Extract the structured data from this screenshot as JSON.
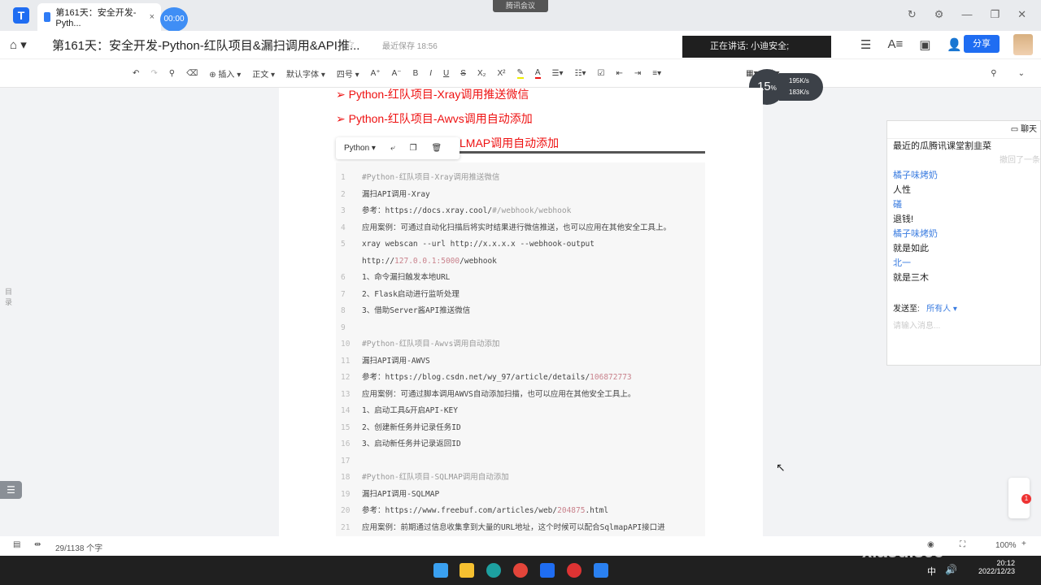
{
  "tabbar": {
    "tab_title": "第161天：安全开发-Pyth...",
    "timer": "00:00",
    "meeting": "腾讯会议"
  },
  "header": {
    "doc_title": "第161天：安全开发-Python-红队项目&漏扫调用&API推...",
    "saved": "最近保存 18:56",
    "speaking": "正在讲话: 小迪安全;",
    "share": "分享"
  },
  "toolbar": {
    "insert": "插入",
    "style": "正文",
    "font": "默认字体",
    "size": "四号"
  },
  "monitor": {
    "cpu": "15",
    "cpu_unit": "%",
    "up": "195K/s",
    "down": "183K/s"
  },
  "doc": {
    "headings": [
      "➢ Python-红队项目-Xray调用推送微信",
      "➢ Python-红队项目-Awvs调用自动添加",
      "LMAP调用自动添加"
    ],
    "code_lang": "Python",
    "code": [
      {
        "n": "1",
        "segs": [
          {
            "t": "#Python-红队项目-Xray调用推送微信",
            "k": "cm"
          }
        ]
      },
      {
        "n": "2",
        "segs": [
          {
            "t": "漏扫API调用-Xray"
          }
        ]
      },
      {
        "n": "3",
        "segs": [
          {
            "t": "参考：https://docs.xray.cool/"
          },
          {
            "t": "#/webhook/webhook",
            "k": "cm"
          }
        ]
      },
      {
        "n": "4",
        "segs": [
          {
            "t": "应用案例：可通过自动化扫描后将实时结果进行微信推送，也可以应用在其他安全工具上。"
          }
        ]
      },
      {
        "n": "5",
        "segs": [
          {
            "t": "xray webscan --url http://x.x.x.x --webhook-output"
          }
        ]
      },
      {
        "n": "",
        "segs": [
          {
            "t": "http://"
          },
          {
            "t": "127.0.0.1:5000",
            "k": "nm"
          },
          {
            "t": "/webhook"
          }
        ]
      },
      {
        "n": "6",
        "segs": [
          {
            "t": "1、命令漏扫触发本地URL"
          }
        ]
      },
      {
        "n": "7",
        "segs": [
          {
            "t": "2、Flask启动进行监听处理"
          }
        ]
      },
      {
        "n": "8",
        "segs": [
          {
            "t": "3、借助Server酱API推送微信"
          }
        ]
      },
      {
        "n": "9",
        "segs": [
          {
            "t": ""
          }
        ]
      },
      {
        "n": "10",
        "segs": [
          {
            "t": "#Python-红队项目-Awvs调用自动添加",
            "k": "cm"
          }
        ]
      },
      {
        "n": "11",
        "segs": [
          {
            "t": "漏扫API调用-AWVS"
          }
        ]
      },
      {
        "n": "12",
        "segs": [
          {
            "t": "参考：https://blog.csdn.net/wy_97/article/details/"
          },
          {
            "t": "106872773",
            "k": "nm"
          }
        ]
      },
      {
        "n": "13",
        "segs": [
          {
            "t": "应用案例：可通过脚本调用AWVS自动添加扫描，也可以应用在其他安全工具上。"
          }
        ]
      },
      {
        "n": "14",
        "segs": [
          {
            "t": "1、启动工具&开启API-KEY"
          }
        ]
      },
      {
        "n": "15",
        "segs": [
          {
            "t": "2、创建新任务并记录任务ID"
          }
        ]
      },
      {
        "n": "16",
        "segs": [
          {
            "t": "3、启动新任务并记录返回ID"
          }
        ]
      },
      {
        "n": "17",
        "segs": [
          {
            "t": ""
          }
        ]
      },
      {
        "n": "18",
        "segs": [
          {
            "t": "#Python-红队项目-SQLMAP调用自动添加",
            "k": "cm"
          }
        ]
      },
      {
        "n": "19",
        "segs": [
          {
            "t": "漏扫API调用-SQLMAP"
          }
        ]
      },
      {
        "n": "20",
        "segs": [
          {
            "t": "参考：https://www.freebuf.com/articles/web/"
          },
          {
            "t": "204875",
            "k": "nm"
          },
          {
            "t": ".html"
          }
        ]
      },
      {
        "n": "21",
        "segs": [
          {
            "t": "应用案例：前期通过信息收集拿到大量的URL地址，这个时候可以配合SqlmapAPI接口进"
          }
        ]
      }
    ]
  },
  "sidebar": {
    "toc": "目录"
  },
  "chat": {
    "title": "聊天",
    "first": "最近的瓜腾讯课堂割韭菜",
    "recalled": "撤回了一条",
    "messages": [
      {
        "nick": "橘子味烤奶",
        "text": "人性"
      },
      {
        "nick": "礒",
        "text": "退钱!"
      },
      {
        "nick": "橘子味烤奶",
        "text": "就是如此"
      },
      {
        "nick": "北一",
        "text": "就是三木"
      }
    ],
    "send_to_label": "发送至:",
    "send_to": "所有人",
    "placeholder": "请输入消息..."
  },
  "status": {
    "word_count": "29/1138 个字",
    "zoom": "100%"
  },
  "taskbar": {
    "time": "20:12",
    "date": "2022/12/23",
    "ime": "中",
    "watermark": "xiaodisec"
  },
  "float": {
    "badge": "1"
  }
}
